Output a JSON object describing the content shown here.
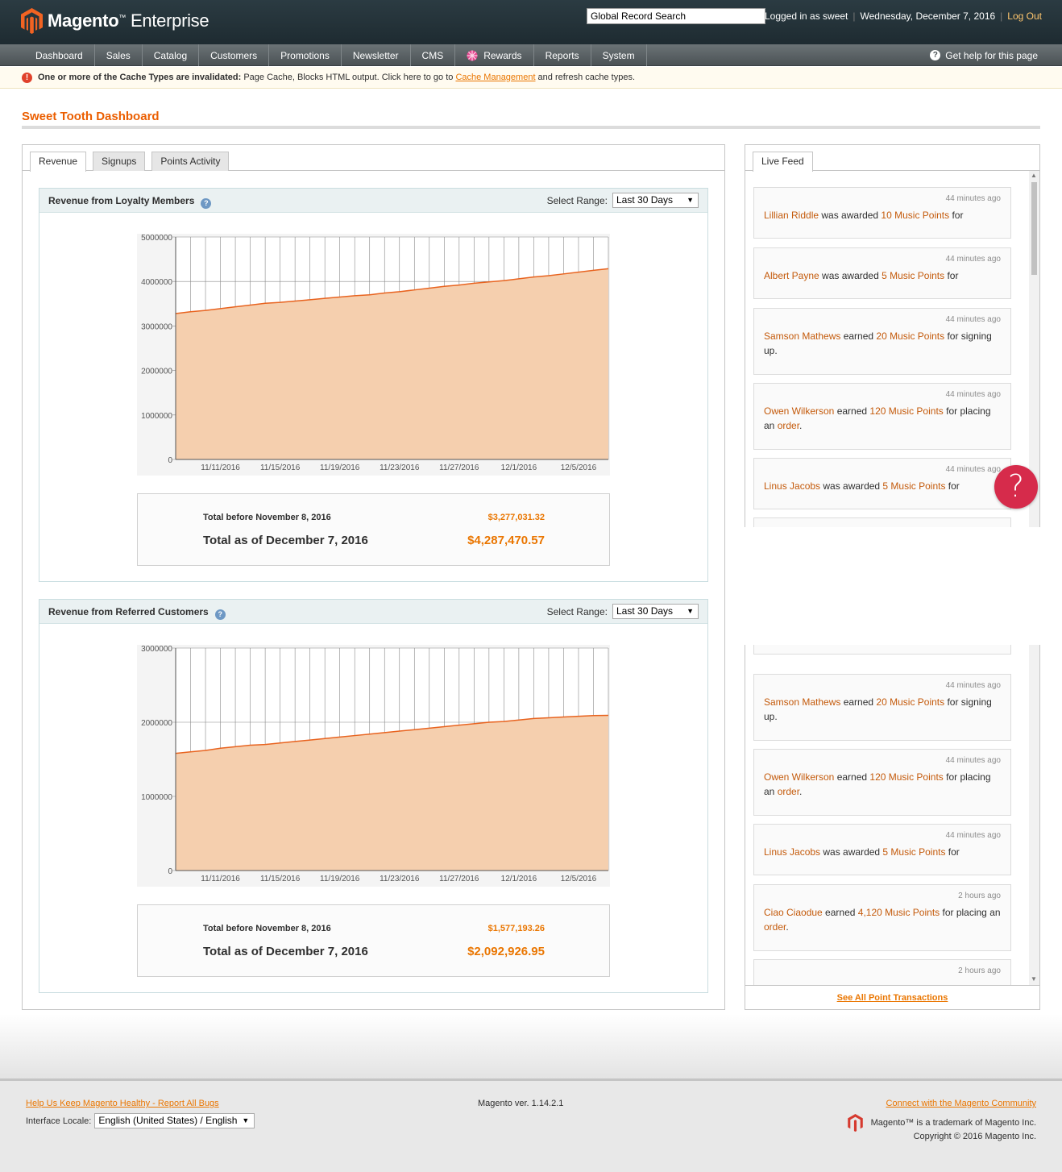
{
  "header": {
    "brand_bold": "Magento",
    "brand_tm": "™",
    "brand_edition": "Enterprise",
    "search_value": "Global Record Search",
    "logged_in": "Logged in as sweet",
    "date": "Wednesday, December 7, 2016",
    "logout": "Log Out"
  },
  "nav": {
    "items": [
      "Dashboard",
      "Sales",
      "Catalog",
      "Customers",
      "Promotions",
      "Newsletter",
      "CMS",
      "Rewards",
      "Reports",
      "System"
    ],
    "help": "Get help for this page"
  },
  "notice": {
    "bold": "One or more of the Cache Types are invalidated:",
    "text": " Page Cache, Blocks HTML output. Click here to go to ",
    "link": "Cache Management",
    "tail": " and refresh cache types."
  },
  "page_title": "Sweet Tooth Dashboard",
  "tabs": [
    "Revenue",
    "Signups",
    "Points Activity"
  ],
  "sections": [
    {
      "title": "Revenue from Loyalty Members",
      "range_label": "Select Range:",
      "range_value": "Last 30 Days",
      "total_before_label": "Total before November 8, 2016",
      "total_before_value": "$3,277,031.32",
      "total_now_label": "Total as of December 7, 2016",
      "total_now_value": "$4,287,470.57"
    },
    {
      "title": "Revenue from Referred Customers",
      "range_label": "Select Range:",
      "range_value": "Last 30 Days",
      "total_before_label": "Total before November 8, 2016",
      "total_before_value": "$1,577,193.26",
      "total_now_label": "Total as of December 7, 2016",
      "total_now_value": "$2,092,926.95"
    }
  ],
  "chart_data": [
    {
      "type": "area",
      "title": "",
      "xlabel": "",
      "ylabel": "",
      "ylim": [
        0,
        5000000
      ],
      "yticks": [
        "0",
        "1000000",
        "2000000",
        "3000000",
        "4000000",
        "5000000"
      ],
      "x_tick_labels": [
        "11/11/2016",
        "11/15/2016",
        "11/19/2016",
        "11/23/2016",
        "11/27/2016",
        "12/1/2016",
        "12/5/2016"
      ],
      "x": [
        "11/8/2016",
        "11/9/2016",
        "11/10/2016",
        "11/11/2016",
        "11/12/2016",
        "11/13/2016",
        "11/14/2016",
        "11/15/2016",
        "11/16/2016",
        "11/17/2016",
        "11/18/2016",
        "11/19/2016",
        "11/20/2016",
        "11/21/2016",
        "11/22/2016",
        "11/23/2016",
        "11/24/2016",
        "11/25/2016",
        "11/26/2016",
        "11/27/2016",
        "11/28/2016",
        "11/29/2016",
        "11/30/2016",
        "12/1/2016",
        "12/2/2016",
        "12/3/2016",
        "12/4/2016",
        "12/5/2016",
        "12/6/2016",
        "12/7/2016"
      ],
      "values": [
        3280000,
        3320000,
        3350000,
        3390000,
        3430000,
        3470000,
        3510000,
        3530000,
        3560000,
        3590000,
        3620000,
        3650000,
        3680000,
        3700000,
        3740000,
        3770000,
        3810000,
        3850000,
        3890000,
        3920000,
        3960000,
        3990000,
        4020000,
        4060000,
        4100000,
        4130000,
        4170000,
        4210000,
        4250000,
        4287471
      ],
      "grid": true,
      "color": "#e8631f",
      "fill": "#f5cfae"
    },
    {
      "type": "area",
      "title": "",
      "xlabel": "",
      "ylabel": "",
      "ylim": [
        0,
        3000000
      ],
      "yticks": [
        "0",
        "1000000",
        "2000000",
        "3000000"
      ],
      "x_tick_labels": [
        "11/11/2016",
        "11/15/2016",
        "11/19/2016",
        "11/23/2016",
        "11/27/2016",
        "12/1/2016",
        "12/5/2016"
      ],
      "x": [
        "11/8/2016",
        "11/9/2016",
        "11/10/2016",
        "11/11/2016",
        "11/12/2016",
        "11/13/2016",
        "11/14/2016",
        "11/15/2016",
        "11/16/2016",
        "11/17/2016",
        "11/18/2016",
        "11/19/2016",
        "11/20/2016",
        "11/21/2016",
        "11/22/2016",
        "11/23/2016",
        "11/24/2016",
        "11/25/2016",
        "11/26/2016",
        "11/27/2016",
        "11/28/2016",
        "11/29/2016",
        "11/30/2016",
        "12/1/2016",
        "12/2/2016",
        "12/3/2016",
        "12/4/2016",
        "12/5/2016",
        "12/6/2016",
        "12/7/2016"
      ],
      "values": [
        1580000,
        1600000,
        1620000,
        1650000,
        1670000,
        1690000,
        1700000,
        1720000,
        1740000,
        1760000,
        1780000,
        1800000,
        1820000,
        1840000,
        1860000,
        1880000,
        1900000,
        1920000,
        1940000,
        1960000,
        1980000,
        2000000,
        2010000,
        2030000,
        2050000,
        2060000,
        2070000,
        2080000,
        2090000,
        2092927
      ],
      "grid": true,
      "color": "#e8631f",
      "fill": "#f5cfae"
    }
  ],
  "live_feed": {
    "tab": "Live Feed",
    "items_top": [
      {
        "time": "44 minutes ago",
        "name": "Lillian Riddle",
        "verb": " was awarded ",
        "points": "10 Music Points",
        "tail": " for",
        "link": "",
        "end": ""
      },
      {
        "time": "44 minutes ago",
        "name": "Albert Payne",
        "verb": " was awarded ",
        "points": "5 Music Points",
        "tail": " for",
        "link": "",
        "end": ""
      },
      {
        "time": "44 minutes ago",
        "name": "Samson Mathews",
        "verb": " earned ",
        "points": "20 Music Points",
        "tail": " for signing up.",
        "link": "",
        "end": ""
      },
      {
        "time": "44 minutes ago",
        "name": "Owen Wilkerson",
        "verb": " earned ",
        "points": "120 Music Points",
        "tail": " for placing an ",
        "link": "order",
        "end": "."
      },
      {
        "time": "44 minutes ago",
        "name": "Linus Jacobs",
        "verb": " was awarded ",
        "points": "5 Music Points",
        "tail": " for",
        "link": "",
        "end": ""
      }
    ],
    "items_bottom": [
      {
        "time": "44 minutes ago",
        "name": "Samson Mathews",
        "verb": " earned ",
        "points": "20 Music Points",
        "tail": " for signing up.",
        "link": "",
        "end": ""
      },
      {
        "time": "44 minutes ago",
        "name": "Owen Wilkerson",
        "verb": " earned ",
        "points": "120 Music Points",
        "tail": " for placing an ",
        "link": "order",
        "end": "."
      },
      {
        "time": "44 minutes ago",
        "name": "Linus Jacobs",
        "verb": " was awarded ",
        "points": "5 Music Points",
        "tail": " for",
        "link": "",
        "end": ""
      },
      {
        "time": "2 hours ago",
        "name": "Ciao Ciaodue",
        "verb": " earned ",
        "points": "4,120 Music Points",
        "tail": " for placing an ",
        "link": "order",
        "end": "."
      },
      {
        "time": "2 hours ago",
        "name": "",
        "verb": "",
        "points": "",
        "tail": "",
        "link": "",
        "end": ""
      }
    ],
    "see_all": "See All Point Transactions",
    "help_bubble": "?"
  },
  "footer": {
    "bugs": "Help Us Keep Magento Healthy - Report All Bugs",
    "locale_label": "Interface Locale:",
    "locale_value": "English (United States) / English",
    "version": "Magento ver. 1.14.2.1",
    "community": "Connect with the Magento Community",
    "trademark": "Magento™ is a trademark of Magento Inc.",
    "copyright": "Copyright © 2016 Magento Inc."
  }
}
